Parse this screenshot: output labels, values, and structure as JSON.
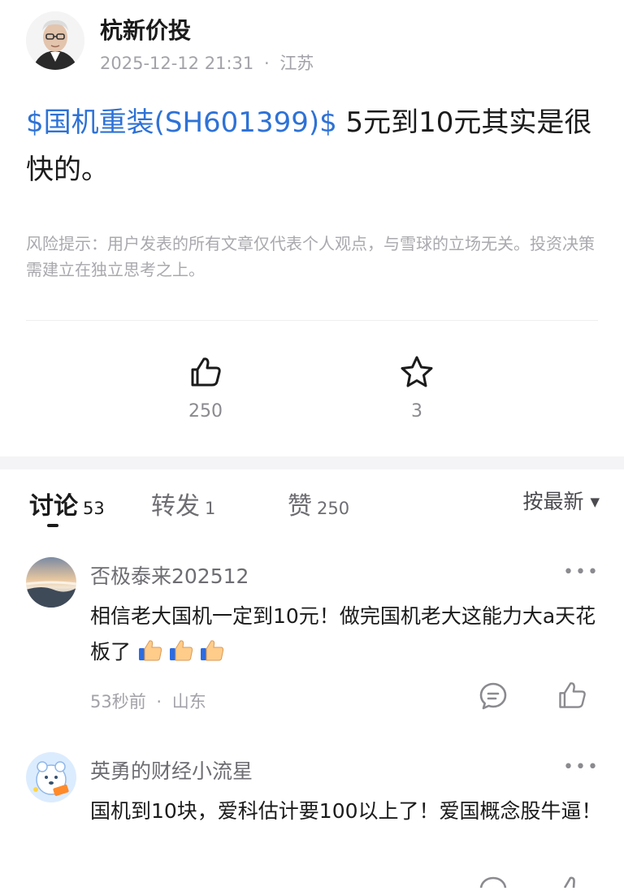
{
  "author": {
    "name": "杭新价投",
    "timestamp": "2025-12-12 21:31",
    "location_sep": "·",
    "location": "江苏"
  },
  "post": {
    "stock_tag": "$国机重装(SH601399)$",
    "text": " 5元到10元其实是很快的。"
  },
  "disclaimer": "风险提示：用户发表的所有文章仅代表个人观点，与雪球的立场无关。投资决策需建立在独立思考之上。",
  "actions": {
    "like_count": "250",
    "favorite_count": "3"
  },
  "tabs": [
    {
      "label": "讨论",
      "count": "53"
    },
    {
      "label": "转发",
      "count": "1"
    },
    {
      "label": "赞",
      "count": "250"
    }
  ],
  "sort": {
    "label": "按最新",
    "caret": "▼"
  },
  "comments": [
    {
      "author": "否极泰来202512",
      "text": "相信老大国机一定到10元！做完国机老大这能力大a天花板了",
      "time": "53秒前",
      "sep": "·",
      "location": "山东",
      "more": "•••"
    },
    {
      "author": "英勇的财经小流星",
      "text": "国机到10块，爱科估计要100以上了！爱国概念股牛逼！",
      "more": "•••"
    }
  ],
  "colors": {
    "link_blue": "#2e72d6",
    "muted_gray": "#a2a2a8",
    "text_dark": "#1b1b1b"
  }
}
